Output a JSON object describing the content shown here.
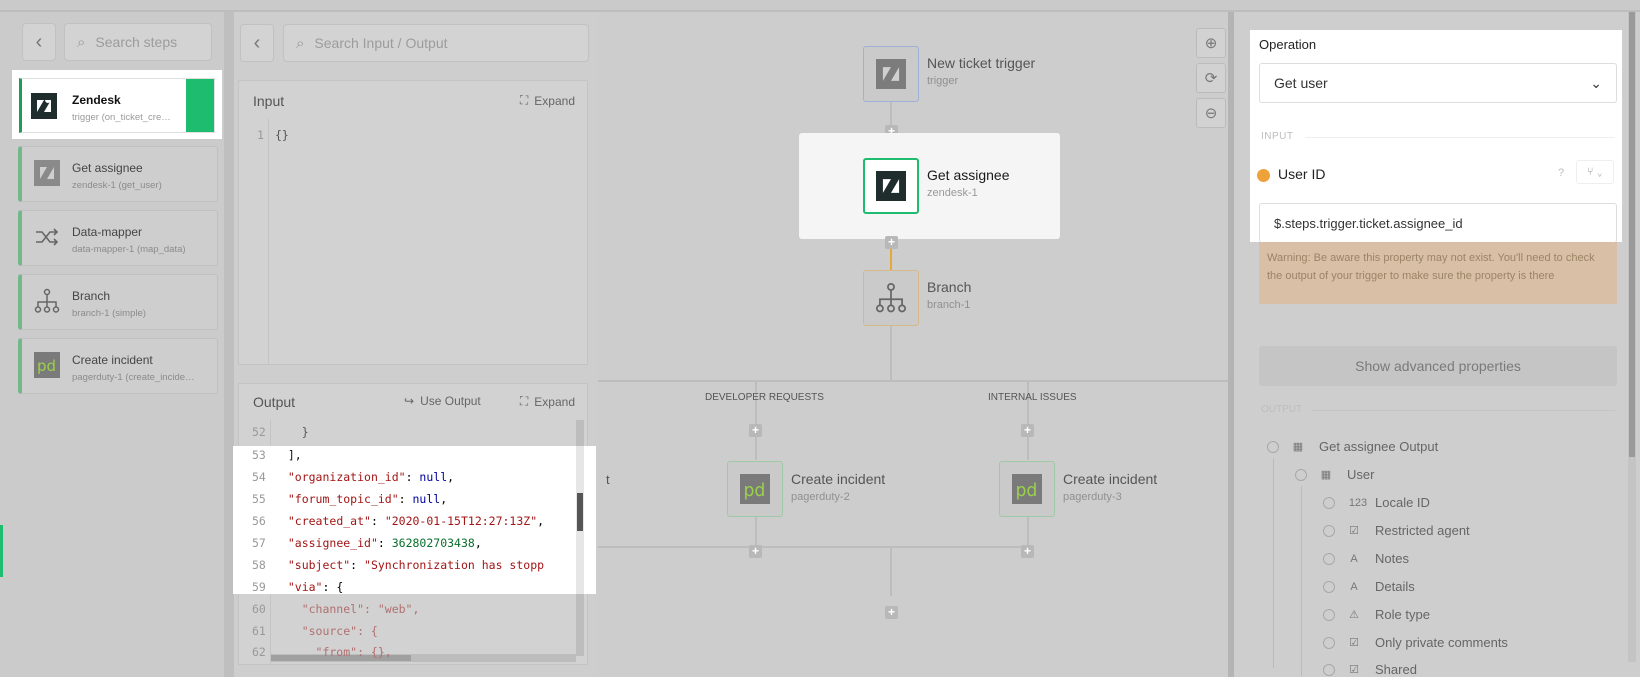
{
  "steps_panel": {
    "search_placeholder": "Search steps",
    "items": [
      {
        "title": "Zendesk",
        "subtitle": "trigger (on_ticket_cre…",
        "icon": "zendesk-icon",
        "active": true
      },
      {
        "title": "Get assignee",
        "subtitle": "zendesk-1 (get_user)",
        "icon": "zendesk-icon"
      },
      {
        "title": "Data-mapper",
        "subtitle": "data-mapper-1 (map_data)",
        "icon": "shuffle-icon"
      },
      {
        "title": "Branch",
        "subtitle": "branch-1 (simple)",
        "icon": "branch-icon"
      },
      {
        "title": "Create incident",
        "subtitle": "pagerduty-1 (create_incide…",
        "icon": "pagerduty-icon"
      }
    ]
  },
  "io_panel": {
    "search_placeholder": "Search Input / Output",
    "input": {
      "title": "Input",
      "expand_label": "Expand",
      "lines": [
        {
          "n": "1",
          "text": "{}"
        }
      ]
    },
    "output": {
      "title": "Output",
      "use_output_label": "Use Output",
      "expand_label": "Expand",
      "lines": [
        {
          "n": "52",
          "text": "    }"
        },
        {
          "n": "53",
          "text": "  ],"
        },
        {
          "n": "54",
          "text": "  \"organization_id\": null,"
        },
        {
          "n": "55",
          "text": "  \"forum_topic_id\": null,"
        },
        {
          "n": "56",
          "text": "  \"created_at\": \"2020-01-15T12:27:13Z\","
        },
        {
          "n": "57",
          "text": "  \"assignee_id\": 362802703438,"
        },
        {
          "n": "58",
          "text": "  \"subject\": \"Synchronization has stopp"
        },
        {
          "n": "59",
          "text": "  \"via\": {"
        },
        {
          "n": "60",
          "text": "    \"channel\": \"web\","
        },
        {
          "n": "61",
          "text": "    \"source\": {"
        },
        {
          "n": "62",
          "text": "      \"from\": {},"
        }
      ]
    }
  },
  "canvas": {
    "nodes": {
      "trigger": {
        "title": "New ticket trigger",
        "subtitle": "trigger"
      },
      "get_assignee": {
        "title": "Get assignee",
        "subtitle": "zendesk-1"
      },
      "branch": {
        "title": "Branch",
        "subtitle": "branch-1"
      },
      "incident2": {
        "title": "Create incident",
        "subtitle": "pagerduty-2"
      },
      "incident3": {
        "title": "Create incident",
        "subtitle": "pagerduty-3"
      }
    },
    "branch_labels": {
      "partial": "t",
      "developer": "DEVELOPER REQUESTS",
      "internal": "INTERNAL ISSUES"
    }
  },
  "right_panel": {
    "operation_label": "Operation",
    "operation_value": "Get user",
    "input_section": "INPUT",
    "user_id_label": "User ID",
    "user_id_value": "$.steps.trigger.ticket.assignee_id",
    "warning": "Warning: Be aware this property may not exist. You'll need to check the output of your trigger to make sure the property is there",
    "advanced_button": "Show advanced properties",
    "output_section": "OUTPUT",
    "tree": [
      {
        "label": "Get assignee Output",
        "icon": "table-icon",
        "glyph": "▦",
        "level": 0
      },
      {
        "label": "User",
        "icon": "table-icon",
        "glyph": "▦",
        "level": 1
      },
      {
        "label": "Locale ID",
        "icon": "number-icon",
        "glyph": "123",
        "level": 2
      },
      {
        "label": "Restricted agent",
        "icon": "checkbox-icon",
        "glyph": "☑",
        "level": 2
      },
      {
        "label": "Notes",
        "icon": "text-icon",
        "glyph": "A",
        "level": 2
      },
      {
        "label": "Details",
        "icon": "text-icon",
        "glyph": "A",
        "level": 2
      },
      {
        "label": "Role type",
        "icon": "warning-icon",
        "glyph": "⚠",
        "level": 2
      },
      {
        "label": "Only private comments",
        "icon": "checkbox-icon",
        "glyph": "☑",
        "level": 2
      },
      {
        "label": "Shared",
        "icon": "checkbox-icon",
        "glyph": "☑",
        "level": 2
      }
    ]
  }
}
